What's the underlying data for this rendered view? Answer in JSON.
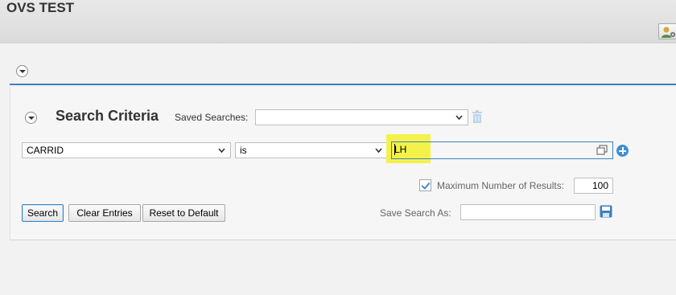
{
  "header": {
    "title": "OVS TEST",
    "personalize_icon": "user-settings-icon"
  },
  "search_criteria": {
    "title": "Search Criteria",
    "saved_searches_label": "Saved Searches:",
    "saved_searches_value": "",
    "field_select": "CARRID",
    "operator_select": "is",
    "value_input": "LH",
    "max_results_checked": true,
    "max_results_label": "Maximum Number of Results:",
    "max_results_value": "100",
    "save_search_as_label": "Save Search As:",
    "save_search_as_value": ""
  },
  "buttons": {
    "search": "Search",
    "clear_entries": "Clear Entries",
    "reset_to_default": "Reset to Default"
  },
  "colors": {
    "accent": "#3b81c4",
    "highlight": "#f4f24a",
    "background": "#f2f2f2"
  }
}
